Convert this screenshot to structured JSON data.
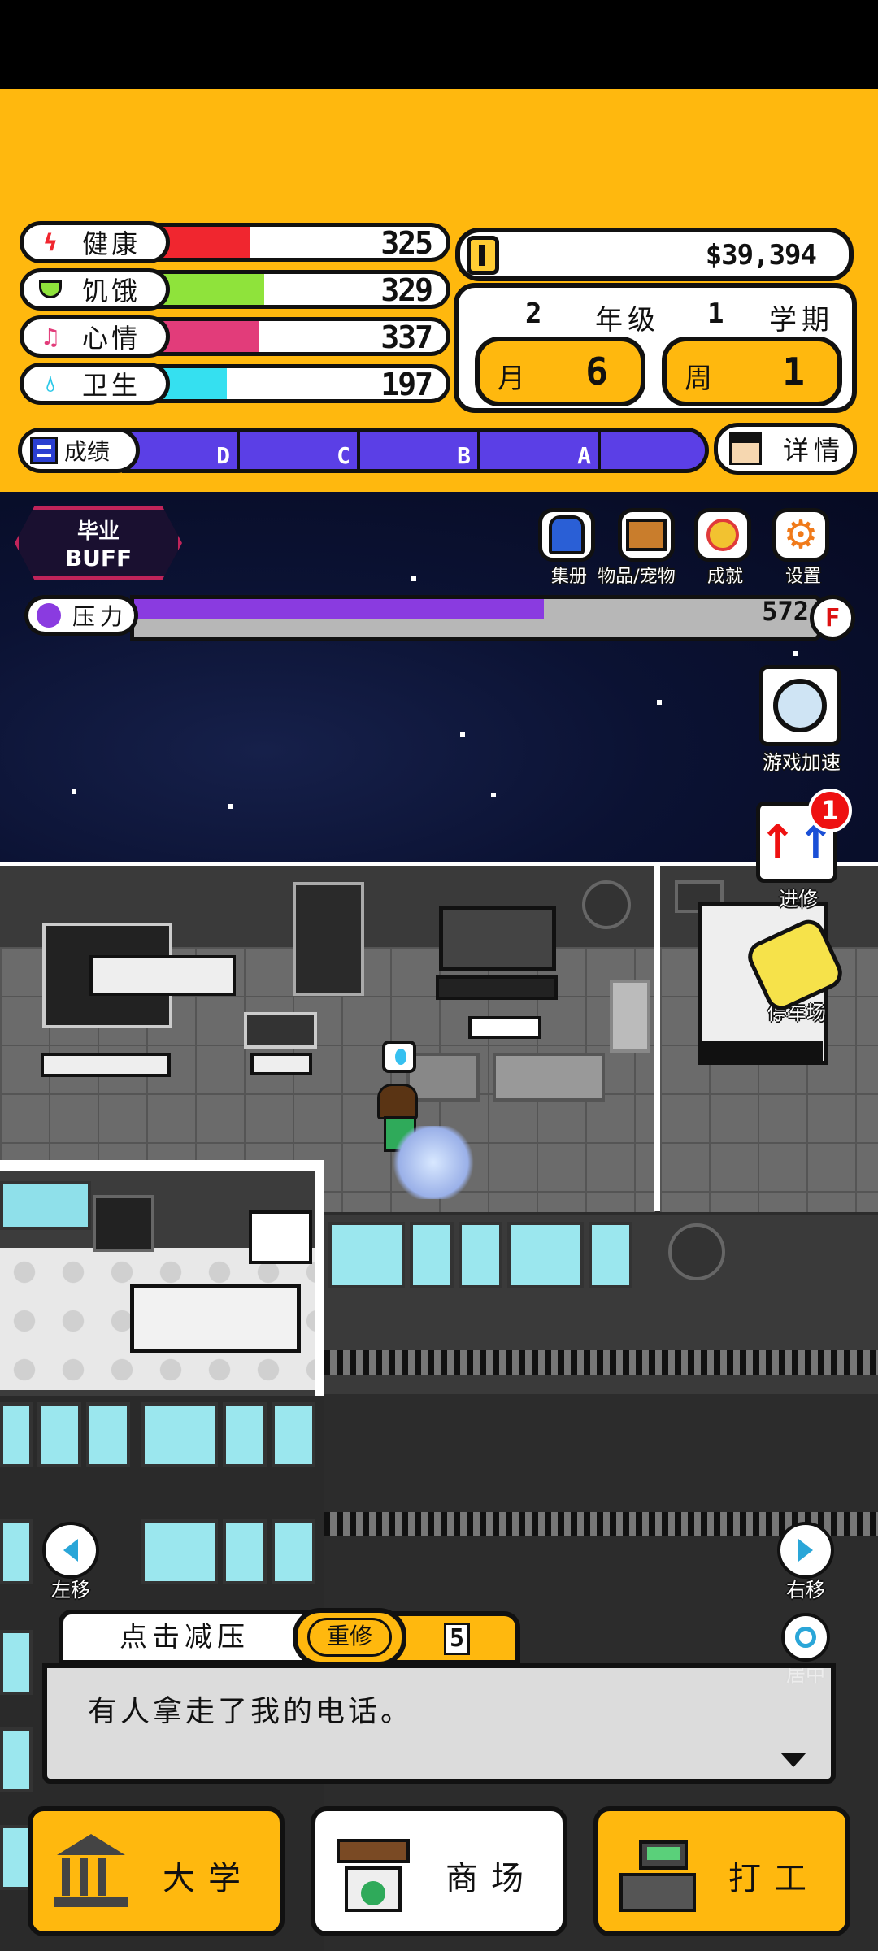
{
  "stats": [
    {
      "label": "健康",
      "value": "325",
      "fill": 0.32,
      "color": "#f0262f",
      "icon": "lightning-icon",
      "icon_color": "#f0262f"
    },
    {
      "label": "饥饿",
      "value": "329",
      "fill": 0.37,
      "color": "#8fe33b",
      "icon": "food-bowl-icon",
      "icon_color": "#8fe33b"
    },
    {
      "label": "心情",
      "value": "337",
      "fill": 0.35,
      "color": "#e23c7a",
      "icon": "music-note-icon",
      "icon_color": "#e23c7a"
    },
    {
      "label": "卫生",
      "value": "197",
      "fill": 0.24,
      "color": "#35e0f0",
      "icon": "water-drop-icon",
      "icon_color": "#2cc8e8"
    }
  ],
  "money": "$39,394",
  "calendar": {
    "grade_num": "2",
    "grade_label": "年级",
    "term_num": "1",
    "term_label": "学期",
    "month_label": "月",
    "month_value": "6",
    "week_label": "周",
    "week_value": "1"
  },
  "grades": {
    "label": "成绩",
    "segments": [
      "D",
      "C",
      "B",
      "A",
      ""
    ]
  },
  "detail_label": "详情",
  "buff": {
    "line1": "毕业",
    "line2": "BUFF"
  },
  "top_icons": [
    {
      "label": "集册",
      "icon": "album-icon",
      "color": "#2a5fd6"
    },
    {
      "label": "物品/宠物",
      "icon": "chest-icon",
      "color": "#c97d2c"
    },
    {
      "label": "成就",
      "icon": "medal-icon",
      "color": "#e03a3a"
    },
    {
      "label": "设置",
      "icon": "gear-icon",
      "color": "#f07a1a"
    }
  ],
  "stress": {
    "label": "压力",
    "value": "572",
    "fill": 0.6,
    "end_label": "F"
  },
  "side_buttons": {
    "speed_label": "游戏加速",
    "upgrade_label": "进修",
    "upgrade_badge": "1",
    "parking_label": "停车场"
  },
  "nav_arrows": {
    "left_label": "左移",
    "right_label": "右移",
    "center_label": "居中"
  },
  "dialog": {
    "tab_label": "点击减压",
    "redo_label": "重修",
    "count": "5",
    "text": "有人拿走了我的电话。"
  },
  "bottom_nav": [
    {
      "label": "大学",
      "icon": "university-icon"
    },
    {
      "label": "商场",
      "icon": "mall-icon"
    },
    {
      "label": "打工",
      "icon": "cash-register-icon"
    }
  ]
}
